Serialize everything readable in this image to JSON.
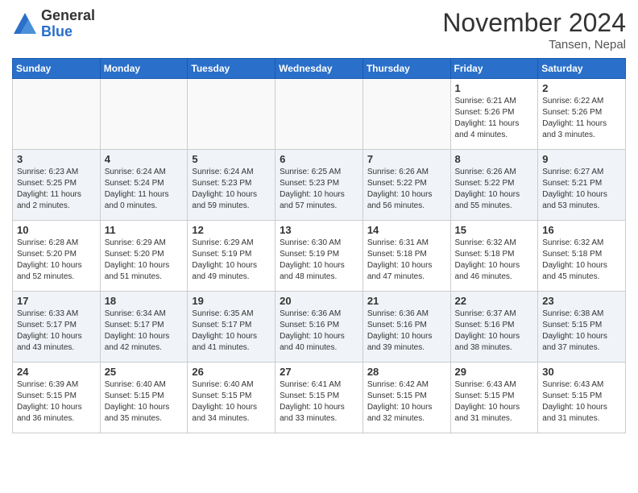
{
  "header": {
    "logo_general": "General",
    "logo_blue": "Blue",
    "month_title": "November 2024",
    "location": "Tansen, Nepal"
  },
  "weekdays": [
    "Sunday",
    "Monday",
    "Tuesday",
    "Wednesday",
    "Thursday",
    "Friday",
    "Saturday"
  ],
  "weeks": [
    [
      {
        "day": "",
        "info": ""
      },
      {
        "day": "",
        "info": ""
      },
      {
        "day": "",
        "info": ""
      },
      {
        "day": "",
        "info": ""
      },
      {
        "day": "",
        "info": ""
      },
      {
        "day": "1",
        "info": "Sunrise: 6:21 AM\nSunset: 5:26 PM\nDaylight: 11 hours and 4 minutes."
      },
      {
        "day": "2",
        "info": "Sunrise: 6:22 AM\nSunset: 5:26 PM\nDaylight: 11 hours and 3 minutes."
      }
    ],
    [
      {
        "day": "3",
        "info": "Sunrise: 6:23 AM\nSunset: 5:25 PM\nDaylight: 11 hours and 2 minutes."
      },
      {
        "day": "4",
        "info": "Sunrise: 6:24 AM\nSunset: 5:24 PM\nDaylight: 11 hours and 0 minutes."
      },
      {
        "day": "5",
        "info": "Sunrise: 6:24 AM\nSunset: 5:23 PM\nDaylight: 10 hours and 59 minutes."
      },
      {
        "day": "6",
        "info": "Sunrise: 6:25 AM\nSunset: 5:23 PM\nDaylight: 10 hours and 57 minutes."
      },
      {
        "day": "7",
        "info": "Sunrise: 6:26 AM\nSunset: 5:22 PM\nDaylight: 10 hours and 56 minutes."
      },
      {
        "day": "8",
        "info": "Sunrise: 6:26 AM\nSunset: 5:22 PM\nDaylight: 10 hours and 55 minutes."
      },
      {
        "day": "9",
        "info": "Sunrise: 6:27 AM\nSunset: 5:21 PM\nDaylight: 10 hours and 53 minutes."
      }
    ],
    [
      {
        "day": "10",
        "info": "Sunrise: 6:28 AM\nSunset: 5:20 PM\nDaylight: 10 hours and 52 minutes."
      },
      {
        "day": "11",
        "info": "Sunrise: 6:29 AM\nSunset: 5:20 PM\nDaylight: 10 hours and 51 minutes."
      },
      {
        "day": "12",
        "info": "Sunrise: 6:29 AM\nSunset: 5:19 PM\nDaylight: 10 hours and 49 minutes."
      },
      {
        "day": "13",
        "info": "Sunrise: 6:30 AM\nSunset: 5:19 PM\nDaylight: 10 hours and 48 minutes."
      },
      {
        "day": "14",
        "info": "Sunrise: 6:31 AM\nSunset: 5:18 PM\nDaylight: 10 hours and 47 minutes."
      },
      {
        "day": "15",
        "info": "Sunrise: 6:32 AM\nSunset: 5:18 PM\nDaylight: 10 hours and 46 minutes."
      },
      {
        "day": "16",
        "info": "Sunrise: 6:32 AM\nSunset: 5:18 PM\nDaylight: 10 hours and 45 minutes."
      }
    ],
    [
      {
        "day": "17",
        "info": "Sunrise: 6:33 AM\nSunset: 5:17 PM\nDaylight: 10 hours and 43 minutes."
      },
      {
        "day": "18",
        "info": "Sunrise: 6:34 AM\nSunset: 5:17 PM\nDaylight: 10 hours and 42 minutes."
      },
      {
        "day": "19",
        "info": "Sunrise: 6:35 AM\nSunset: 5:17 PM\nDaylight: 10 hours and 41 minutes."
      },
      {
        "day": "20",
        "info": "Sunrise: 6:36 AM\nSunset: 5:16 PM\nDaylight: 10 hours and 40 minutes."
      },
      {
        "day": "21",
        "info": "Sunrise: 6:36 AM\nSunset: 5:16 PM\nDaylight: 10 hours and 39 minutes."
      },
      {
        "day": "22",
        "info": "Sunrise: 6:37 AM\nSunset: 5:16 PM\nDaylight: 10 hours and 38 minutes."
      },
      {
        "day": "23",
        "info": "Sunrise: 6:38 AM\nSunset: 5:15 PM\nDaylight: 10 hours and 37 minutes."
      }
    ],
    [
      {
        "day": "24",
        "info": "Sunrise: 6:39 AM\nSunset: 5:15 PM\nDaylight: 10 hours and 36 minutes."
      },
      {
        "day": "25",
        "info": "Sunrise: 6:40 AM\nSunset: 5:15 PM\nDaylight: 10 hours and 35 minutes."
      },
      {
        "day": "26",
        "info": "Sunrise: 6:40 AM\nSunset: 5:15 PM\nDaylight: 10 hours and 34 minutes."
      },
      {
        "day": "27",
        "info": "Sunrise: 6:41 AM\nSunset: 5:15 PM\nDaylight: 10 hours and 33 minutes."
      },
      {
        "day": "28",
        "info": "Sunrise: 6:42 AM\nSunset: 5:15 PM\nDaylight: 10 hours and 32 minutes."
      },
      {
        "day": "29",
        "info": "Sunrise: 6:43 AM\nSunset: 5:15 PM\nDaylight: 10 hours and 31 minutes."
      },
      {
        "day": "30",
        "info": "Sunrise: 6:43 AM\nSunset: 5:15 PM\nDaylight: 10 hours and 31 minutes."
      }
    ]
  ]
}
